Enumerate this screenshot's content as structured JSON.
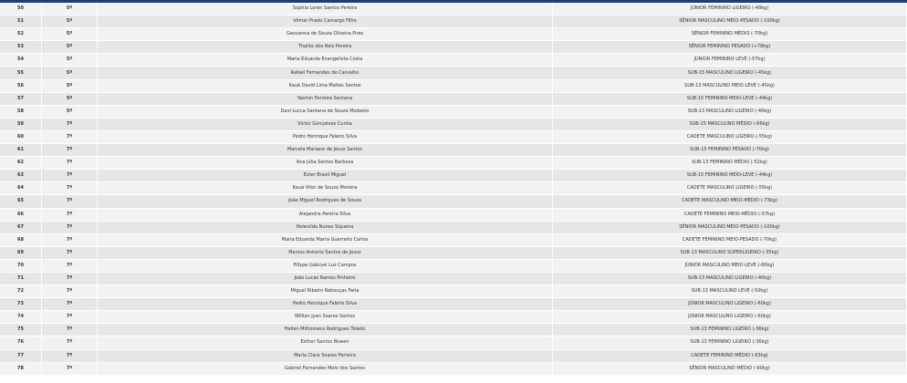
{
  "rows": [
    {
      "num": "50",
      "place": "5º",
      "name": "Sophia Loren Santos Pereira",
      "category": "JÚNIOR FEMININO LIGEIRO (-48kg)"
    },
    {
      "num": "51",
      "place": "5º",
      "name": "Vilmar Prado Camargo Filho",
      "category": "SÊNIOR MASCULINO MEIO-PESADO (-100kg)"
    },
    {
      "num": "52",
      "place": "5º",
      "name": "Geovanna de Souza Oliveira Pires",
      "category": "SÊNIOR FEMININO MÉDIO (-70kg)"
    },
    {
      "num": "53",
      "place": "5º",
      "name": "Thalita dos Reis Pereira",
      "category": "SÊNIOR FEMININO PESADO (+78kg)"
    },
    {
      "num": "54",
      "place": "5º",
      "name": "Maria Eduarda Evangelista Costa",
      "category": "JÚNIOR FEMININO LEVE (-57kg)"
    },
    {
      "num": "55",
      "place": "5º",
      "name": "Rafael Fernandes de Carvalho",
      "category": "SUB-15 MASCULINO LIGEIRO (-45kg)"
    },
    {
      "num": "56",
      "place": "5º",
      "name": "Kauã David Lima Matias Santos",
      "category": "SUB-13 MASCULINO MEIO-LEVE (-45kg)"
    },
    {
      "num": "57",
      "place": "5º",
      "name": "Yasmin Ferreira Santana",
      "category": "SUB-15 FEMININO MEIO-LEVE (-44kg)"
    },
    {
      "num": "58",
      "place": "5º",
      "name": "Davi Lucca Santana de Souza Modesto",
      "category": "SUB-13 MASCULINO LIGEIRO (-40kg)"
    },
    {
      "num": "59",
      "place": "7º",
      "name": "Victor Gonçalves Cunha",
      "category": "SUB-15 MASCULINO MÉDIO (-66kg)"
    },
    {
      "num": "60",
      "place": "7º",
      "name": "Pedro Henrique Faleiro Silva",
      "category": "CADETE MASCULINO LIGEIRO (-55kg)"
    },
    {
      "num": "61",
      "place": "7º",
      "name": "Marcela Mariane de Jesus Santos",
      "category": "SUB-15 FEMININO PESADO (-70kg)"
    },
    {
      "num": "62",
      "place": "7º",
      "name": "Ana Júlia Santos Barbosa",
      "category": "SUB-13 FEMININO MÉDIO (-52kg)"
    },
    {
      "num": "63",
      "place": "7º",
      "name": "Ester Brasil Miguel",
      "category": "SUB-15 FEMININO MEIO-LEVE (-44kg)"
    },
    {
      "num": "64",
      "place": "7º",
      "name": "Kauã Vitor de Souza Moreira",
      "category": "CADETE MASCULINO LIGEIRO (-55kg)"
    },
    {
      "num": "65",
      "place": "7º",
      "name": "João Miguel Rodrigues de Souza",
      "category": "CADETE MASCULINO MEIO-MÉDIO (-73kg)"
    },
    {
      "num": "66",
      "place": "7º",
      "name": "Alejandra Pereira Silva",
      "category": "CADETE FEMININO MEIO-MÉDIO (-57kg)"
    },
    {
      "num": "67",
      "place": "7º",
      "name": "Helenilda Nunes Siqueira",
      "category": "SÊNIOR MASCULINO MEIO-PESADO (-100kg)"
    },
    {
      "num": "68",
      "place": "7º",
      "name": "Maria Eduarda Marra Guerreiro Carlos",
      "category": "CADETE FEMININO MEIO-PESADO (-70kg)"
    },
    {
      "num": "69",
      "place": "7º",
      "name": "Marcos Antonio Santos de Jesus",
      "category": "SUB-13 MASCULINO SUPERLIGEIRO (-35kg)"
    },
    {
      "num": "70",
      "place": "7º",
      "name": "Fillype Gabryel Luz Campos",
      "category": "JÚNIOR MASCULINO MEIO-LEVE (-66kg)"
    },
    {
      "num": "71",
      "place": "7º",
      "name": "João Lucas Ramos Pinheiro",
      "category": "SUB-13 MASCULINO LIGEIRO (-40kg)"
    },
    {
      "num": "72",
      "place": "7º",
      "name": "Miguel Ribeiro Rebouças Faria",
      "category": "SUB-13 MASCULINO LEVE (-50kg)"
    },
    {
      "num": "73",
      "place": "7º",
      "name": "Pedro Henrique Faleiro Silva",
      "category": "JÚNIOR MASCULINO LIGEIRO (-60kg)"
    },
    {
      "num": "74",
      "place": "7º",
      "name": "Willian Jyan Soares Santos",
      "category": "JÚNIOR MASCULINO LIGEIRO (-60kg)"
    },
    {
      "num": "75",
      "place": "7º",
      "name": "Hellen Milhomens Rodrigues Toledo",
      "category": "SUB-13 FEMININO LIGEIRO (-36kg)"
    },
    {
      "num": "76",
      "place": "7º",
      "name": "Esther Santos Bowen",
      "category": "SUB-13 FEMININO LIGEIRO (-36kg)"
    },
    {
      "num": "77",
      "place": "7º",
      "name": "Maria Clara Soares Ferreira",
      "category": "CADETE FEMININO MÉDIO (-63kg)"
    },
    {
      "num": "78",
      "place": "7º",
      "name": "Gabriel Fernandes Melo dos Santos",
      "category": "SÊNIOR MASCULINO MÉDIO (-90kg)"
    }
  ]
}
